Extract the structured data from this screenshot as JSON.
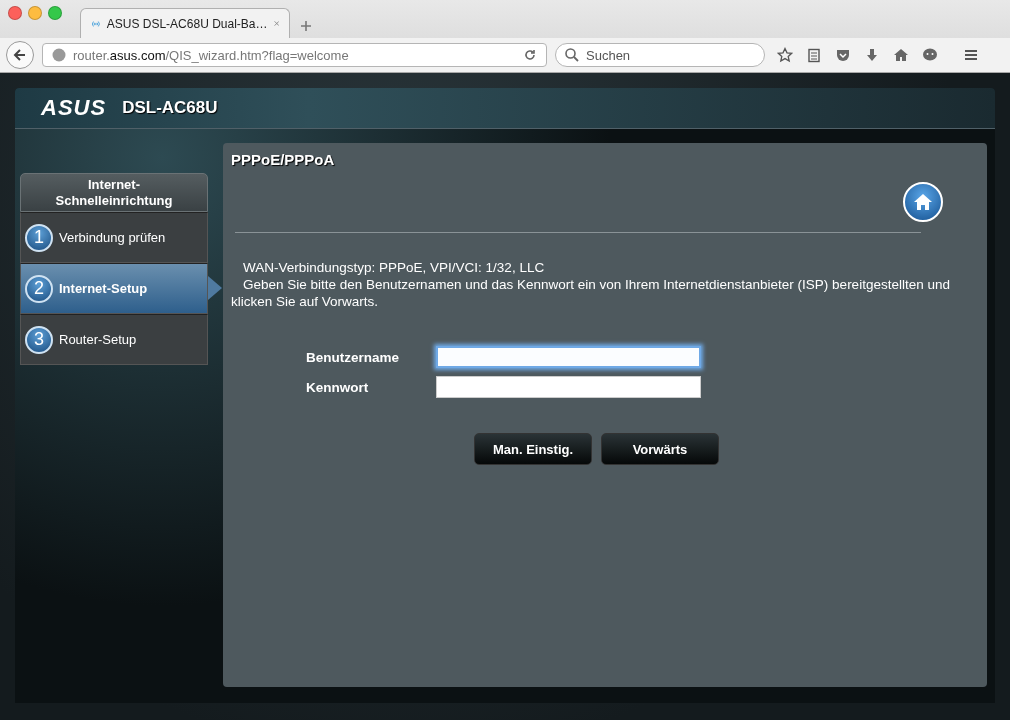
{
  "browser": {
    "tabs": [
      {
        "title": "ASUS DSL-AC68U Dual-Ba…",
        "selected": true
      }
    ],
    "url": "router.**asus.com**/QIS_wizard.htm?flag=welcome",
    "search": {
      "placeholder": "Suchen"
    }
  },
  "header": {
    "logo": "ASUS",
    "model": "DSL-AC68U"
  },
  "sidebar": {
    "title": "Internet-Schnelleinrichtung",
    "steps": [
      {
        "number": "1",
        "label": "Verbindung prüfen",
        "selected": false
      },
      {
        "number": "2",
        "label": "Internet-Setup",
        "selected": true
      },
      {
        "number": "3",
        "label": "Router-Setup",
        "selected": false
      }
    ]
  },
  "panel": {
    "title": "PPPoE/PPPoA",
    "info": [
      "WAN-Verbindungstyp: PPPoE, VPI/VCI: 1/32, LLC",
      "Geben Sie bitte den Benutzernamen und das Kennwort ein von Ihrem Internetdienstanbieter (ISP) bereitgestellten und klicken Sie auf Vorwarts."
    ],
    "fields": [
      {
        "label": "Benutzername",
        "focused": true
      },
      {
        "label": "Kennwort",
        "focused": false
      }
    ],
    "buttons": [
      "Man. Einstig.",
      "Vorwärts"
    ]
  }
}
